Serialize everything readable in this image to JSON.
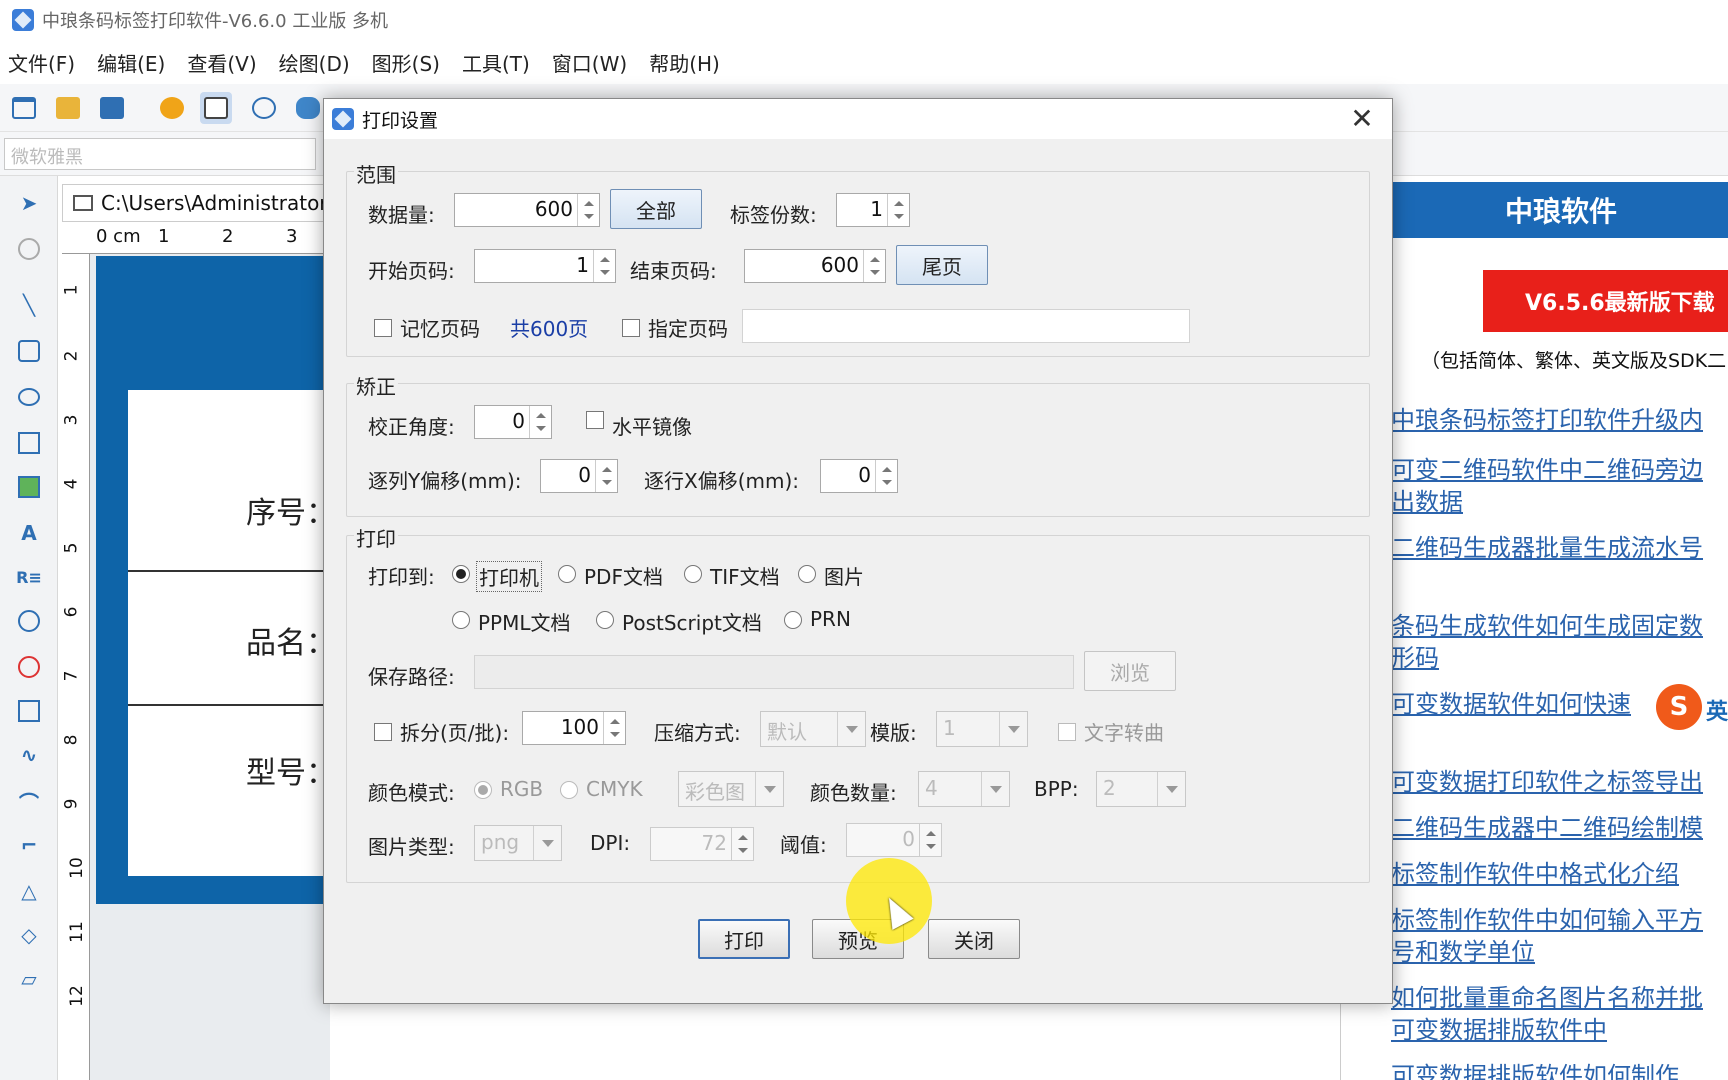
{
  "window": {
    "title": "中琅条码标签打印软件-V6.6.0 工业版 多机"
  },
  "menu": [
    "文件(F)",
    "编辑(E)",
    "查看(V)",
    "绘图(D)",
    "图形(S)",
    "工具(T)",
    "窗口(W)",
    "帮助(H)"
  ],
  "fontbar": {
    "font_name": "微软雅黑"
  },
  "document": {
    "tab_path": "C:\\Users\\Administrator",
    "ruler_top": [
      "0 cm",
      "1",
      "2",
      "3"
    ],
    "ruler_left": [
      "1",
      "2",
      "3",
      "4",
      "5",
      "6",
      "7",
      "8",
      "9",
      "10",
      "11",
      "12"
    ],
    "label_fields": [
      "序号：",
      "品名：",
      "型号："
    ]
  },
  "right_panel": {
    "header": "中琅软件",
    "banner": "V6.5.6最新版下载",
    "note": "（包括简体、繁体、英文版及SDK二",
    "links": [
      "中琅条码标签打印软件升级内",
      "可变二维码软件中二维码旁边",
      "出数据",
      "二维码生成器批量生成流水号",
      "条码生成软件如何生成固定数",
      "形码",
      "可变数据软件如何快速",
      "可变数据打印软件之标签导出",
      "二维码生成器中二维码绘制模",
      "标签制作软件中格式化介绍",
      "标签制作软件中如何输入平方",
      "号和数学单位",
      "如何批量重命名图片名称并批",
      "可变数据排版软件中",
      "可变数据排版软件如何制作"
    ],
    "sogou": "英"
  },
  "dialog": {
    "title": "打印设置",
    "close": "✕",
    "range": {
      "title": "范围",
      "data_count_label": "数据量:",
      "data_count": "600",
      "all_button": "全部",
      "copies_label": "标签份数:",
      "copies": "1",
      "start_page_label": "开始页码:",
      "start_page": "1",
      "end_page_label": "结束页码:",
      "end_page": "600",
      "last_page_button": "尾页",
      "remember_page": "记忆页码",
      "total_pages": "共600页",
      "specify_page": "指定页码",
      "specify_value": ""
    },
    "correction": {
      "title": "矫正",
      "angle_label": "校正角度:",
      "angle": "0",
      "mirror": "水平镜像",
      "col_y_label": "逐列Y偏移(mm):",
      "col_y": "0",
      "row_x_label": "逐行X偏移(mm):",
      "row_x": "0"
    },
    "print": {
      "title": "打印",
      "print_to_label": "打印到:",
      "targets": [
        "打印机",
        "PDF文档",
        "TIF文档",
        "图片",
        "PPML文档",
        "PostScript文档",
        "PRN"
      ],
      "selected_target": "打印机",
      "save_path_label": "保存路径:",
      "save_path": "",
      "browse_button": "浏览",
      "split_label": "拆分(页/批):",
      "split": "100",
      "compress_label": "压缩方式:",
      "compress": "默认",
      "template_label": "模版:",
      "template": "1",
      "text_to_curve": "文字转曲",
      "color_mode_label": "颜色模式:",
      "color_modes": [
        "RGB",
        "CMYK"
      ],
      "selected_color_mode": "RGB",
      "color_type": "彩色图",
      "color_count_label": "颜色数量:",
      "color_count": "4",
      "bpp_label": "BPP:",
      "bpp": "2",
      "image_type_label": "图片类型:",
      "image_type": "png",
      "dpi_label": "DPI:",
      "dpi": "72",
      "threshold_label": "阈值:",
      "threshold": "0"
    },
    "buttons": {
      "print": "打印",
      "preview": "预览",
      "close": "关闭"
    }
  }
}
